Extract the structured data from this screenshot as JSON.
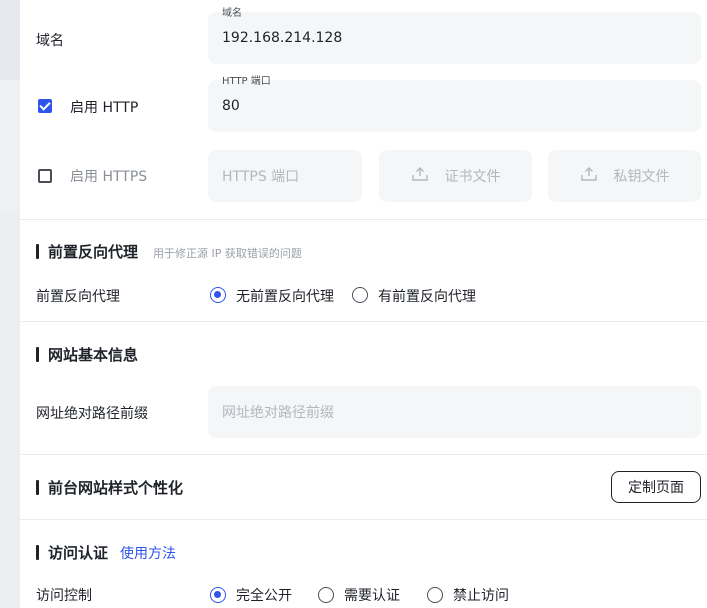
{
  "domain_row": {
    "label": "域名",
    "field_label": "域名",
    "value": "192.168.214.128"
  },
  "http_row": {
    "label": "启用 HTTP",
    "checked": true,
    "field_label": "HTTP 端口",
    "value": "80"
  },
  "https_row": {
    "label": "启用 HTTPS",
    "checked": false,
    "port_placeholder": "HTTPS 端口",
    "cert_label": "证书文件",
    "key_label": "私钥文件"
  },
  "proxy_section": {
    "title": "前置反向代理",
    "hint": "用于修正源 IP 获取错误的问题",
    "row_label": "前置反向代理",
    "options": [
      {
        "label": "无前置反向代理",
        "selected": true
      },
      {
        "label": "有前置反向代理",
        "selected": false
      }
    ]
  },
  "site_section": {
    "title": "网站基本信息",
    "row_label": "网址绝对路径前缀",
    "placeholder": "网址绝对路径前缀"
  },
  "style_section": {
    "title": "前台网站样式个性化",
    "button_label": "定制页面"
  },
  "auth_section": {
    "title": "访问认证",
    "link_label": "使用方法",
    "row_label": "访问控制",
    "options": [
      {
        "label": "完全公开",
        "selected": true
      },
      {
        "label": "需要认证",
        "selected": false
      },
      {
        "label": "禁止访问",
        "selected": false
      }
    ]
  },
  "colors": {
    "accent": "#2f54eb",
    "text": "#1f2329",
    "muted": "#b3b7be",
    "field_bg": "#f5f6f8"
  }
}
